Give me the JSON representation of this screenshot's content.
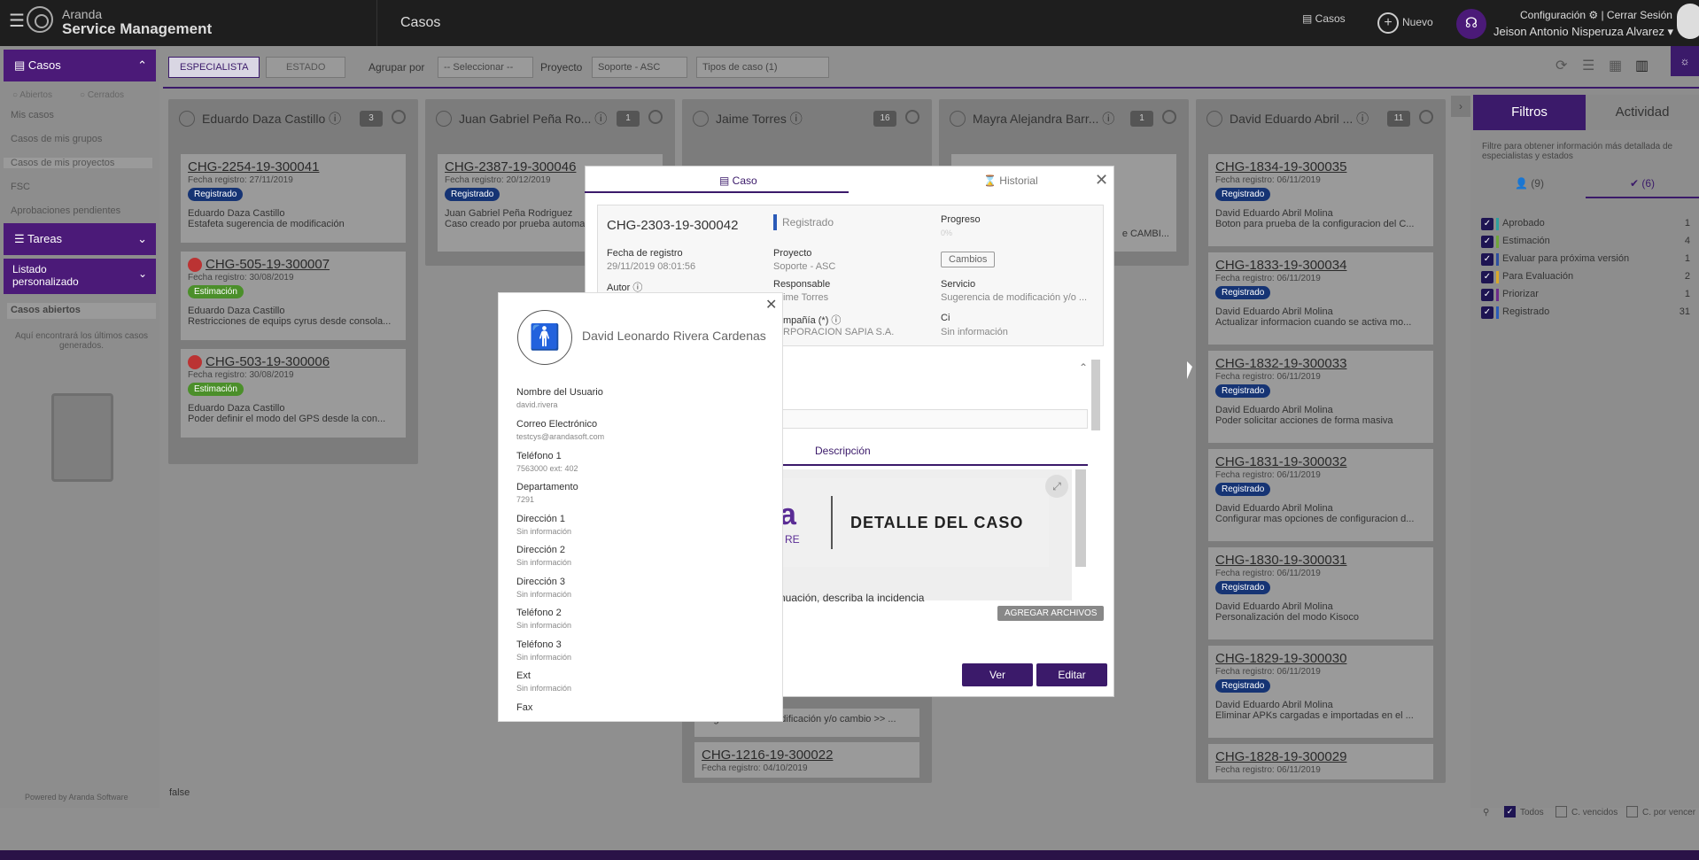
{
  "topbar": {
    "brand_line1": "Aranda",
    "brand_line2": "Service Management",
    "title": "Casos",
    "casos_label": "Casos",
    "nuevo_label": "Nuevo",
    "config_label": "Configuración ⚙ | Cerrar Sesión",
    "user_label": "Jeison Antonio Nisperuza Alvarez ▾"
  },
  "sidebar": {
    "casos_title": "Casos",
    "radio_open": "Abiertos",
    "radio_closed": "Cerrados",
    "items": [
      "Mis casos",
      "Casos de mis grupos",
      "Casos de mis proyectos",
      "FSC",
      "Aprobaciones pendientes"
    ],
    "tareas_title": "Tareas",
    "listado_title": "Listado personalizado",
    "abiertos_title": "Casos abiertos",
    "abiertos_desc": "Aquí encontrará los últimos casos generados.",
    "powered": "Powered by Aranda Software"
  },
  "debug_text": "false",
  "toolbar": {
    "especialista": "ESPECIALISTA",
    "estado": "ESTADO",
    "agrupar_label": "Agrupar por",
    "agrupar_value": "-- Seleccionar --",
    "proyecto_label": "Proyecto",
    "proyecto_value": "Soporte - ASC",
    "tipos_value": "Tipos de caso (1)"
  },
  "columns": [
    {
      "name": "Eduardo Daza Castillo",
      "count": "3"
    },
    {
      "name": "Juan Gabriel Peña Ro...",
      "count": "1"
    },
    {
      "name": "Jaime Torres",
      "count": "16"
    },
    {
      "name": "Mayra Alejandra Barr...",
      "count": "1"
    },
    {
      "name": "David Eduardo Abril ...",
      "count": "11"
    }
  ],
  "col1_cards": [
    {
      "id": "CHG-2254-19-300041",
      "date": "Fecha registro: 27/11/2019",
      "status": "Registrado",
      "owner": "Eduardo Daza Castillo",
      "desc": "Estafeta sugerencia de modificación"
    },
    {
      "id": "CHG-505-19-300007",
      "date": "Fecha registro: 30/08/2019",
      "status": "Estimación",
      "owner": "Eduardo Daza Castillo",
      "desc": "Restricciones de equips cyrus desde consola..."
    },
    {
      "id": "CHG-503-19-300006",
      "date": "Fecha registro: 30/08/2019",
      "status": "Estimación",
      "owner": "Eduardo Daza Castillo",
      "desc": "Poder definir el modo del GPS desde la con..."
    }
  ],
  "col2_cards": [
    {
      "id": "CHG-2387-19-300046",
      "date": "Fecha registro: 20/12/2019",
      "status": "Registrado",
      "owner": "Juan Gabriel Peña Rodriguez",
      "desc": "Caso creado por prueba automa"
    }
  ],
  "col3_bottom": {
    "desc": "Sugerencia de modificación y/o cambio >> ...",
    "id": "CHG-1216-19-300022",
    "date": "Fecha registro: 04/10/2019"
  },
  "col4_partial": {
    "desc": "e CAMBI..."
  },
  "col5_cards": [
    {
      "id": "CHG-1834-19-300035",
      "date": "Fecha registro: 06/11/2019",
      "status": "Registrado",
      "owner": "David Eduardo Abril Molina",
      "desc": "Boton para prueba de la configuracion del C..."
    },
    {
      "id": "CHG-1833-19-300034",
      "date": "Fecha registro: 06/11/2019",
      "status": "Registrado",
      "owner": "David Eduardo Abril Molina",
      "desc": "Actualizar informacion cuando se activa mo..."
    },
    {
      "id": "CHG-1832-19-300033",
      "date": "Fecha registro: 06/11/2019",
      "status": "Registrado",
      "owner": "David Eduardo Abril Molina",
      "desc": "Poder solicitar acciones de forma masiva"
    },
    {
      "id": "CHG-1831-19-300032",
      "date": "Fecha registro: 06/11/2019",
      "status": "Registrado",
      "owner": "David Eduardo Abril Molina",
      "desc": "Configurar mas opciones de configuracion d..."
    },
    {
      "id": "CHG-1830-19-300031",
      "date": "Fecha registro: 06/11/2019",
      "status": "Registrado",
      "owner": "David Eduardo Abril Molina",
      "desc": "Personalización del modo Kisoco"
    },
    {
      "id": "CHG-1829-19-300030",
      "date": "Fecha registro: 06/11/2019",
      "status": "Registrado",
      "owner": "David Eduardo Abril Molina",
      "desc": "Eliminar APKs cargadas e importadas en el ..."
    },
    {
      "id": "CHG-1828-19-300029",
      "date": "Fecha registro: 06/11/2019"
    }
  ],
  "right_panel": {
    "filtros": "Filtros",
    "actividad": "Actividad",
    "desc": "Filtre para obtener información más detallada de especialistas y estados",
    "tab_people": "(9)",
    "tab_states": "(6)",
    "filters": [
      {
        "label": "Aprobado",
        "count": "1",
        "color": "#2e9e9e"
      },
      {
        "label": "Estimación",
        "count": "4",
        "color": "#6fa53a"
      },
      {
        "label": "Evaluar para próxima versión",
        "count": "1",
        "color": "#2d4ea0"
      },
      {
        "label": "Para Evaluación",
        "count": "2",
        "color": "#d9a72b"
      },
      {
        "label": "Priorizar",
        "count": "1",
        "color": "#6a2a8a"
      },
      {
        "label": "Registrado",
        "count": "31",
        "color": "#2a5ab8"
      }
    ],
    "bottom_todos": "Todos",
    "bottom_vencidos": "C. vencidos",
    "bottom_por_vencer": "C. por vencer"
  },
  "modal": {
    "tab_caso": "Caso",
    "tab_historial": "Historial",
    "case_id": "CHG-2303-19-300042",
    "status": "Registrado",
    "progreso_label": "Progreso",
    "progreso_value": "0%",
    "fecha_label": "Fecha de registro",
    "fecha_value": "29/11/2019 08:01:56",
    "proyecto_label": "Proyecto",
    "proyecto_value": "Soporte - ASC",
    "cambios": "Cambios",
    "autor_label": "Autor",
    "responsable_label": "Responsable",
    "responsable_value": "ime Torres",
    "servicio_label": "Servicio",
    "servicio_value": "Sugerencia de modificación y/o ...",
    "compania_label": "mpañía (*)",
    "compania_value": "RPORACION SAPIA S.A.",
    "ci_label": "Ci",
    "ci_value": "Sin información",
    "descripcion_tab": "Descripción",
    "banner_title": "DETALLE DEL CASO",
    "banner_logo": "a",
    "banner_sub": "RE",
    "cont_text": "nuación, describa la incidencia",
    "agregar": "AGREGAR ARCHIVOS",
    "ver": "Ver",
    "editar": "Editar"
  },
  "user_popup": {
    "name": "David Leonardo Rivera Cardenas",
    "fields": [
      {
        "label": "Nombre del Usuario",
        "value": "david.rivera"
      },
      {
        "label": "Correo Electrónico",
        "value": "testcys@arandasoft.com"
      },
      {
        "label": "Teléfono 1",
        "value": "7563000 ext: 402"
      },
      {
        "label": "Departamento",
        "value": "7291"
      },
      {
        "label": "Dirección 1",
        "value": "Sin información"
      },
      {
        "label": "Dirección 2",
        "value": "Sin información"
      },
      {
        "label": "Dirección 3",
        "value": "Sin información"
      },
      {
        "label": "Teléfono 2",
        "value": "Sin información"
      },
      {
        "label": "Teléfono 3",
        "value": "Sin información"
      },
      {
        "label": "Ext",
        "value": "Sin información"
      },
      {
        "label": "Fax",
        "value": ""
      }
    ]
  }
}
